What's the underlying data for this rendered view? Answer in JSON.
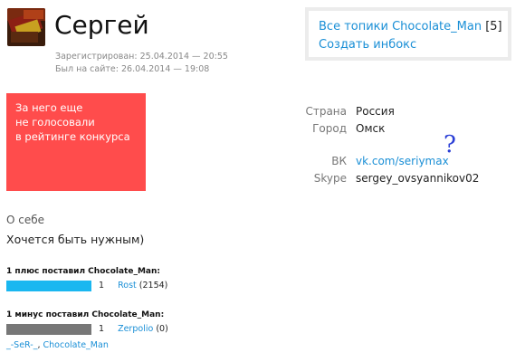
{
  "profile": {
    "username": "Сергей",
    "registered": "Зарегистрирован: 25.04.2014 — 20:55",
    "last_seen": "Был на сайте: 26.04.2014 — 19:08",
    "avatar_icon": "avatar-photo-icon"
  },
  "side_links": {
    "all_topics_label": "Все топики Chocolate_Man",
    "all_topics_count": "[5]",
    "create_inbox_label": "Создать инбокс"
  },
  "contest_notice": {
    "line1": "За него еще",
    "line2": "не голосовали",
    "line3": "в рейтинге конкурса",
    "color": "#ff4c4c"
  },
  "info": {
    "country_label": "Страна",
    "country_value": "Россия",
    "city_label": "Город",
    "city_value": "Омск",
    "vk_label": "ВК",
    "vk_value": "vk.com/seriymax",
    "question_mark": "?",
    "skype_label": "Skype",
    "skype_value": "sergey_ovsyannikov02"
  },
  "about": {
    "title": "О себе",
    "text": "Хочется быть нужным)"
  },
  "votes": {
    "plus": {
      "title": "1 плюс поставил Chocolate_Man:",
      "count": "1",
      "user": "Rost",
      "user_score": "(2154)",
      "bar_color": "#1ab7f0"
    },
    "minus": {
      "title": "1 минус поставил Chocolate_Man:",
      "count": "1",
      "user": "Zerpolio",
      "user_score": "(0)",
      "bar_color": "#777777"
    },
    "voters": {
      "first": "_-SeR-_",
      "separator": ",",
      "second": "Chocolate_Man"
    }
  },
  "colors": {
    "link": "#1a8fd6",
    "accent_red": "#ff4c4c"
  }
}
